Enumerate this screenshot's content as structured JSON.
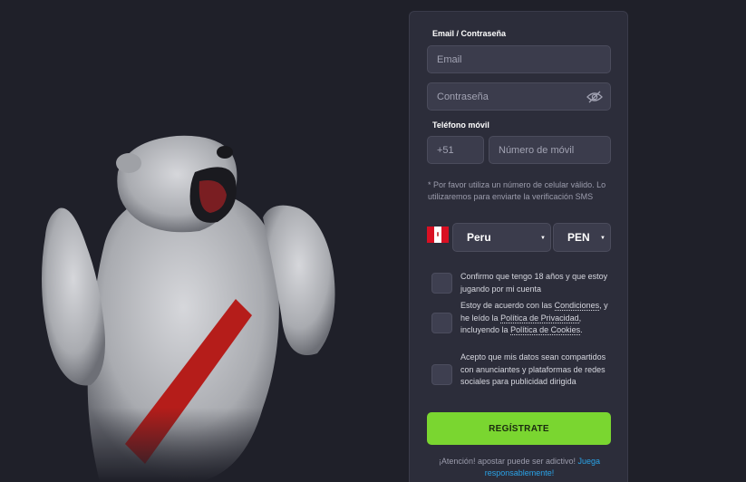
{
  "form": {
    "login_section_label": "Email / Contraseña",
    "email_placeholder": "Email",
    "password_placeholder": "Contraseña",
    "phone_section_label": "Teléfono móvil",
    "phone_code": "+51",
    "phone_placeholder": "Número de móvil",
    "hint": "* Por favor utiliza un número de celular válido. Lo utilizaremos para enviarte la verificación SMS",
    "country": "Peru",
    "currency": "PEN",
    "checks": {
      "age": "Confirmo que tengo 18 años y que estoy jugando por mi cuenta",
      "terms_prefix": "Estoy de acuerdo con las",
      "terms_link": "Condiciones",
      "terms_mid": ", y he leído la",
      "privacy_link": "Política de Privacidad",
      "terms_mid2": ", incluyendo la",
      "cookies_link": "Política de Cookies",
      "terms_end": ".",
      "share": "Acepto que mis datos sean compartidos con anunciantes y plataformas de redes sociales para publicidad dirigida"
    },
    "submit_label": "REGÍSTRATE",
    "warning_text": "¡Atención! apostar puede ser adictivo!",
    "warning_link": "Juega responsablemente!"
  },
  "colors": {
    "background": "#1f2029",
    "panel": "#2c2d3a",
    "input": "#3b3c4c",
    "accent_green": "#7ad630",
    "link_blue": "#2aa3e8",
    "flag_red": "#d91023"
  },
  "icons": {
    "password_toggle": "eye-slash-icon",
    "flag": "peru-flag-icon",
    "select_caret": "caret-down-icon"
  }
}
